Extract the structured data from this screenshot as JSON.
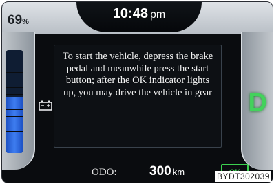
{
  "status": {
    "battery_percent": "69",
    "battery_percent_unit": "%",
    "battery_level": 0.55
  },
  "clock": {
    "time": "10:48",
    "period": "pm"
  },
  "message": {
    "text": "To start the vehicle, depress the brake pedal and meanwhile press the start button; after the OK indicator lights up, you may drive the vehicle in gear"
  },
  "gear": {
    "position": "D"
  },
  "odometer": {
    "label": "ODO:",
    "value": "300",
    "unit": "km"
  },
  "indicators": {
    "ok": "OK"
  },
  "figure_code": "BYDT302039",
  "colors": {
    "gear_green": "#43d25b",
    "battery_blue": "#3e7df0",
    "panel_black": "#0a0c0f"
  },
  "icons": {
    "battery": "battery-icon"
  }
}
